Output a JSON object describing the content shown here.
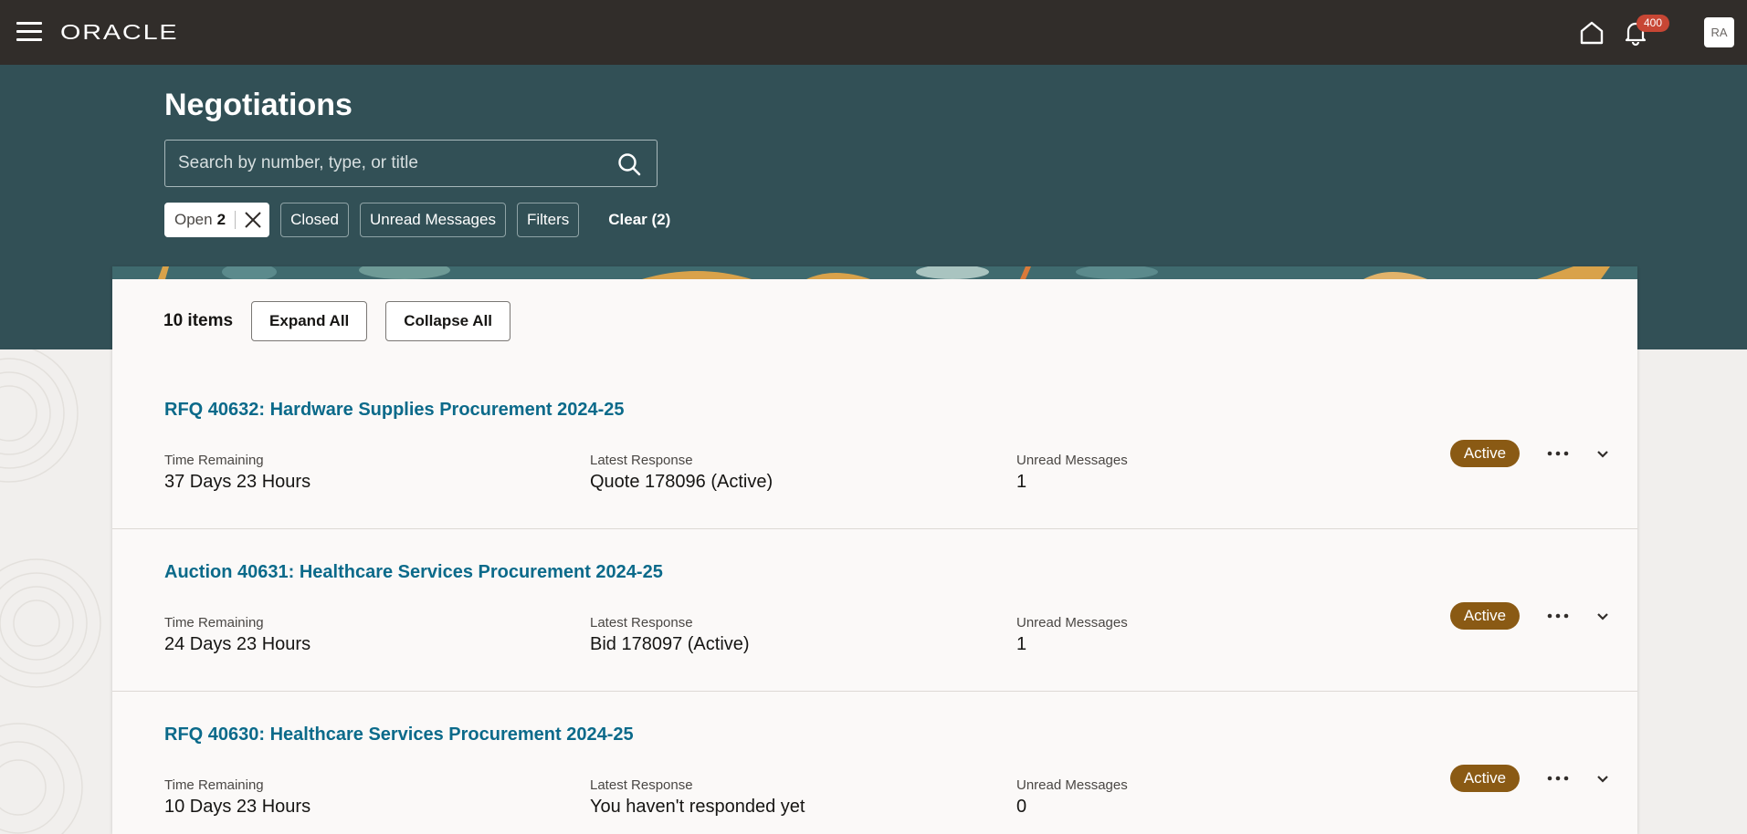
{
  "header": {
    "logo_text": "ORACLE",
    "notification_count": "400",
    "avatar_initials": "RA"
  },
  "page": {
    "title": "Negotiations"
  },
  "search": {
    "placeholder": "Search by number, type, or title",
    "value": ""
  },
  "filters": {
    "open_label": "Open",
    "open_count": "2",
    "closed_label": "Closed",
    "unread_label": "Unread Messages",
    "filters_label": "Filters",
    "clear_label": "Clear (2)"
  },
  "list": {
    "items_count": "10 items",
    "expand_all": "Expand All",
    "collapse_all": "Collapse All",
    "labels": {
      "time_remaining": "Time Remaining",
      "latest_response": "Latest Response",
      "unread_messages": "Unread Messages"
    },
    "rows": [
      {
        "title": "RFQ 40632: Hardware Supplies Procurement 2024-25",
        "time_remaining": "37 Days 23 Hours",
        "latest_response": "Quote 178096 (Active)",
        "unread_messages": "1",
        "status": "Active"
      },
      {
        "title": "Auction 40631: Healthcare Services Procurement 2024-25",
        "time_remaining": "24 Days 23 Hours",
        "latest_response": "Bid 178097 (Active)",
        "unread_messages": "1",
        "status": "Active"
      },
      {
        "title": "RFQ 40630: Healthcare Services Procurement 2024-25",
        "time_remaining": "10 Days 23 Hours",
        "latest_response": "You haven't responded yet",
        "unread_messages": "0",
        "status": "Active"
      }
    ]
  },
  "colors": {
    "topbar": "#312d2a",
    "hero": "#325056",
    "link": "#0b6a8a",
    "status_active": "#8a5a14",
    "badge": "#c74634"
  }
}
